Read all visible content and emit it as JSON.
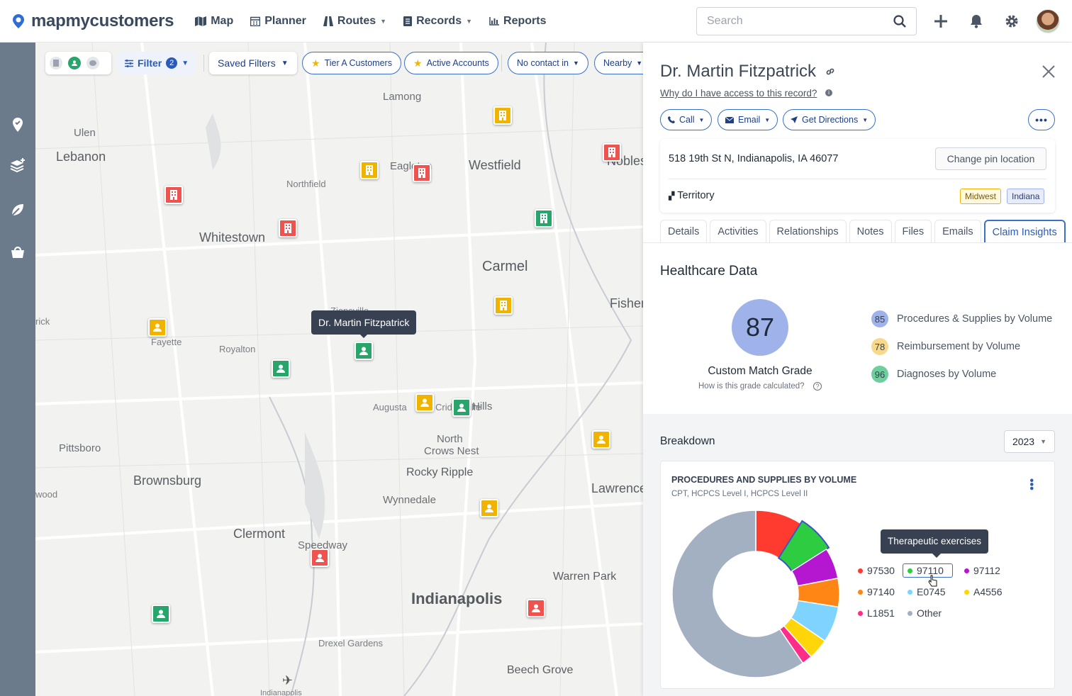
{
  "app": {
    "brand": "mapmycustomers"
  },
  "nav": {
    "items": [
      {
        "label": "Map",
        "icon": "map-icon",
        "caret": false
      },
      {
        "label": "Planner",
        "icon": "calendar-icon",
        "caret": false
      },
      {
        "label": "Routes",
        "icon": "routes-icon",
        "caret": true
      },
      {
        "label": "Records",
        "icon": "records-icon",
        "caret": true
      },
      {
        "label": "Reports",
        "icon": "chart-icon",
        "caret": false
      }
    ]
  },
  "search": {
    "placeholder": "Search"
  },
  "filters": {
    "filter_label": "Filter",
    "filter_count": "2",
    "saved_filters": "Saved Filters",
    "chips": [
      "Tier A Customers",
      "Active Accounts"
    ],
    "no_contact": "No contact in",
    "nearby": "Nearby"
  },
  "map": {
    "labels": [
      "Lamong",
      "Ulen",
      "Lebanon",
      "Northfield",
      "Eagleton",
      "Westfield",
      "Noblesville",
      "Whitestown",
      "Carmel",
      "Fishers",
      "Zionsville",
      "Fayette",
      "Royalton",
      "rick",
      "Augusta",
      "Cridersville",
      "Hills",
      "North",
      "Crows Nest",
      "Pittsboro",
      "Brownsburg",
      "Rocky Ripple",
      "Lawrence",
      "wood",
      "Wynnedale",
      "Clermont",
      "Speedway",
      "Warren Park",
      "Indianapolis",
      "Drexel Gardens",
      "Beech Grove",
      "Indianapolis"
    ],
    "tooltip": "Dr. Martin Fitzpatrick"
  },
  "record": {
    "title": "Dr. Martin Fitzpatrick",
    "access_link": "Why do I have access to this record?",
    "actions": [
      "Call",
      "Email",
      "Get Directions"
    ],
    "address": "518 19th St N, Indianapolis, IA 46077",
    "change_pin": "Change pin location",
    "territory_label": "Territory",
    "territories": [
      "Midwest",
      "Indiana"
    ],
    "tabs": [
      "Details",
      "Activities",
      "Relationships",
      "Notes",
      "Files",
      "Emails",
      "Claim Insights"
    ],
    "active_tab": "Claim Insights"
  },
  "healthcare": {
    "heading": "Healthcare Data",
    "grade": "87",
    "grade_label": "Custom Match Grade",
    "grade_help": "How is this grade calculated?",
    "subgrades": [
      {
        "score": "85",
        "label": "Procedures & Supplies by Volume",
        "color": "#9fb2ea"
      },
      {
        "score": "78",
        "label": "Reimbursement by Volume",
        "color": "#f7d98b"
      },
      {
        "score": "96",
        "label": "Diagnoses by Volume",
        "color": "#6ccf9c"
      }
    ]
  },
  "breakdown": {
    "heading": "Breakdown",
    "year": "2023",
    "chart_title": "PROCEDURES AND SUPPLIES BY VOLUME",
    "chart_subtitle": "CPT, HCPCS Level I, HCPCS Level II",
    "tooltip": "Therapeutic exercises"
  },
  "chart_data": {
    "type": "pie",
    "title": "PROCEDURES AND SUPPLIES BY VOLUME",
    "subtitle": "CPT, HCPCS Level I, HCPCS Level II",
    "categories": [
      "97530",
      "97110",
      "97112",
      "97140",
      "E0745",
      "A4556",
      "L1851",
      "Other"
    ],
    "values": [
      9,
      7,
      6,
      5.5,
      7,
      4,
      2,
      59.5
    ],
    "colors": [
      "#ff3b30",
      "#2ecc40",
      "#b517d1",
      "#ff8614",
      "#7fd4ff",
      "#ffd60a",
      "#ff2d87",
      "#a3b0c2"
    ],
    "highlighted": "97110",
    "legend_position": "right"
  }
}
